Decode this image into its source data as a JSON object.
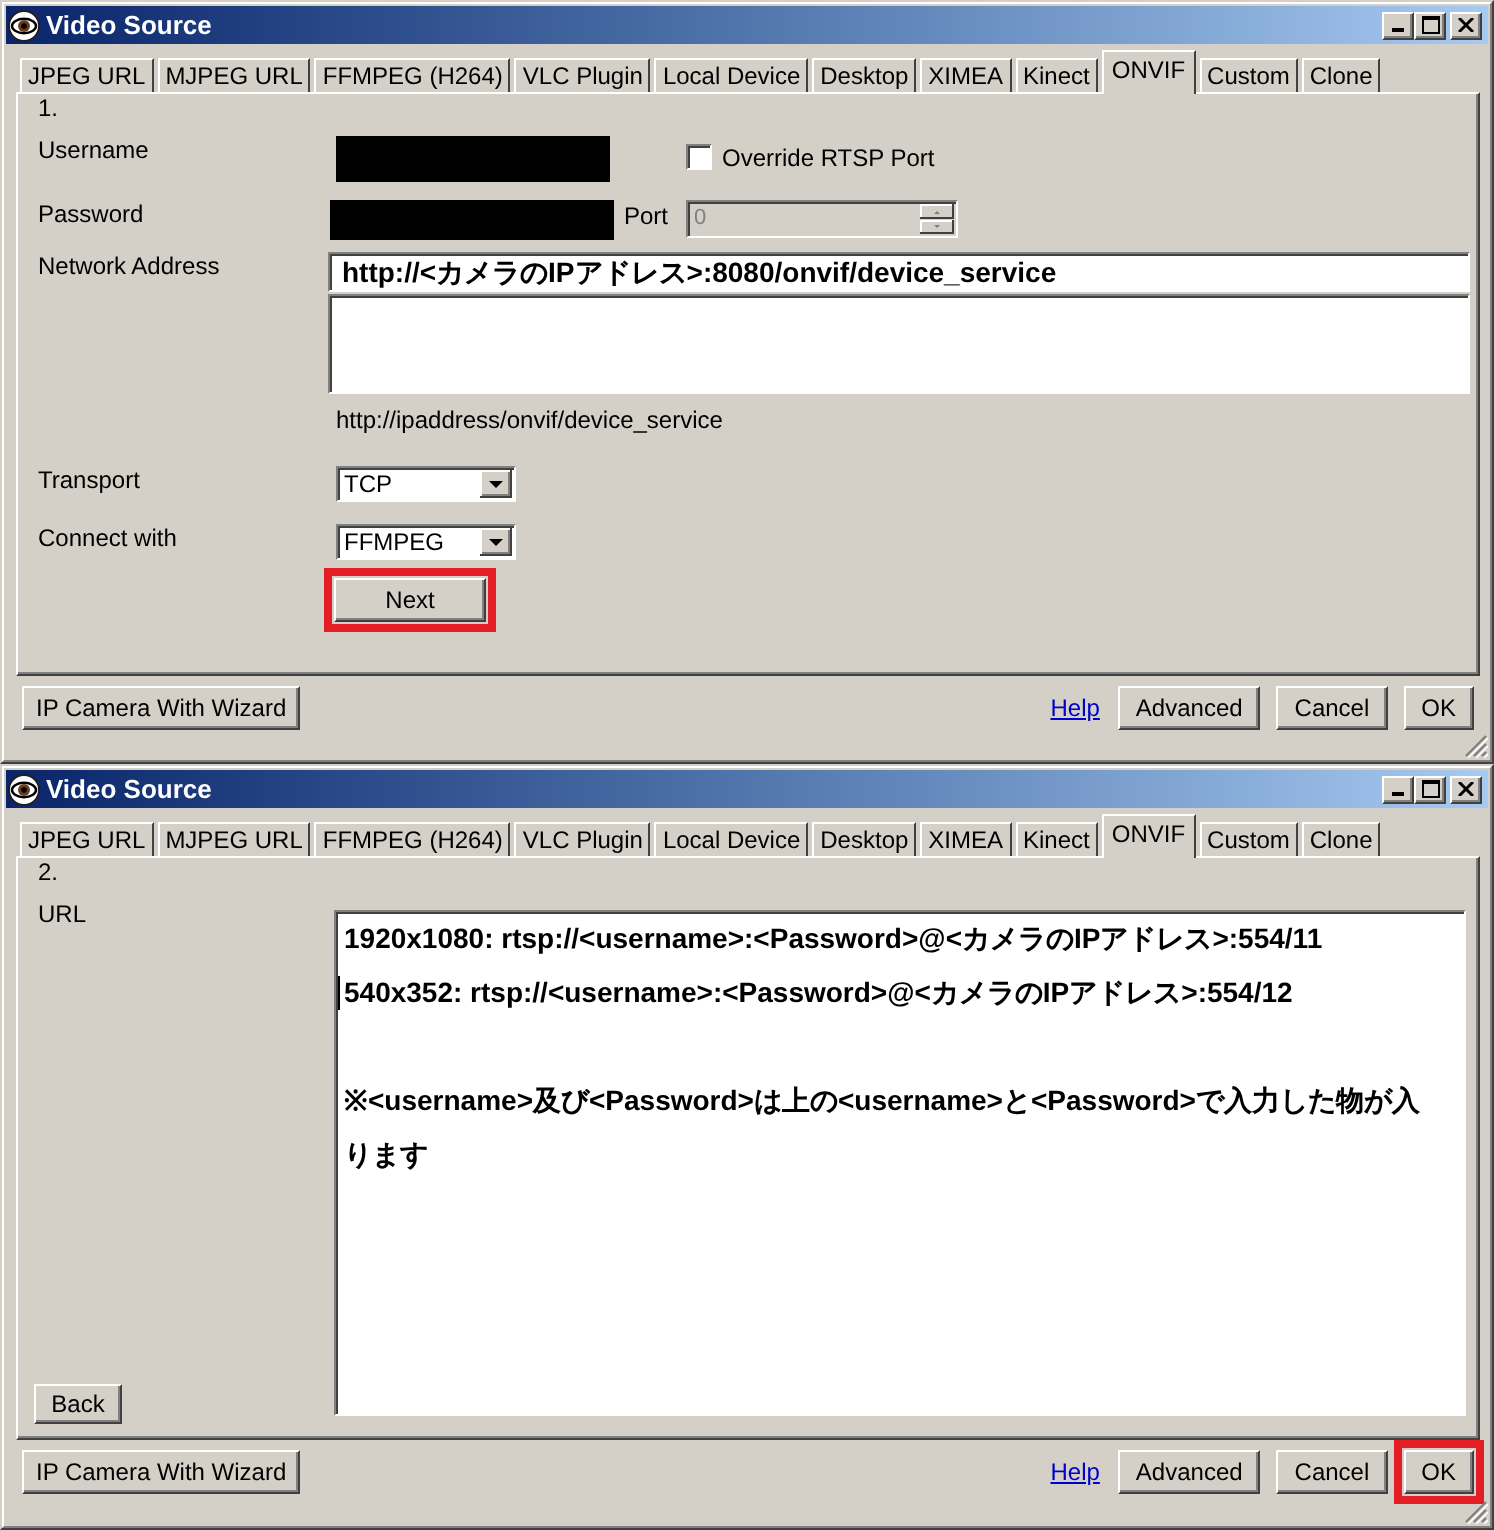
{
  "windows": [
    {
      "title": "Video Source",
      "tabs": [
        {
          "label": "JPEG URL",
          "selected": false
        },
        {
          "label": "MJPEG URL",
          "selected": false
        },
        {
          "label": "FFMPEG (H264)",
          "selected": false
        },
        {
          "label": "VLC Plugin",
          "selected": false
        },
        {
          "label": "Local Device",
          "selected": false
        },
        {
          "label": "Desktop",
          "selected": false
        },
        {
          "label": "XIMEA",
          "selected": false
        },
        {
          "label": "Kinect",
          "selected": false
        },
        {
          "label": "ONVIF",
          "selected": true
        },
        {
          "label": "Custom",
          "selected": false
        },
        {
          "label": "Clone",
          "selected": false
        }
      ],
      "panel": {
        "kind": "connection",
        "step": "1.",
        "username": {
          "label": "Username",
          "redacted": true
        },
        "override_rtsp_port": {
          "label": "Override RTSP Port",
          "checked": false
        },
        "password": {
          "label": "Password",
          "redacted": true
        },
        "port": {
          "label": "Port",
          "value": "0",
          "disabled": true
        },
        "network_address": {
          "label": "Network Address",
          "value": "http://<カメラのIPアドレス>:8080/onvif/device_service",
          "example": "http://ipaddress/onvif/device_service"
        },
        "transport": {
          "label": "Transport",
          "value": "TCP"
        },
        "connect_with": {
          "label": "Connect with",
          "value": "FFMPEG"
        },
        "next_button": {
          "label": "Next",
          "highlighted": true
        }
      },
      "footer": {
        "wizard_button": "IP Camera With Wizard",
        "help_link": "Help",
        "buttons": [
          {
            "label": "Advanced",
            "highlighted": false
          },
          {
            "label": "Cancel",
            "highlighted": false
          },
          {
            "label": "OK",
            "highlighted": false
          }
        ]
      }
    },
    {
      "title": "Video Source",
      "tabs": [
        {
          "label": "JPEG URL",
          "selected": false
        },
        {
          "label": "MJPEG URL",
          "selected": false
        },
        {
          "label": "FFMPEG (H264)",
          "selected": false
        },
        {
          "label": "VLC Plugin",
          "selected": false
        },
        {
          "label": "Local Device",
          "selected": false
        },
        {
          "label": "Desktop",
          "selected": false
        },
        {
          "label": "XIMEA",
          "selected": false
        },
        {
          "label": "Kinect",
          "selected": false
        },
        {
          "label": "ONVIF",
          "selected": true
        },
        {
          "label": "Custom",
          "selected": false
        },
        {
          "label": "Clone",
          "selected": false
        }
      ],
      "panel": {
        "kind": "urls",
        "step": "2.",
        "url": {
          "label": "URL",
          "lines": [
            {
              "text": "1920x1080: rtsp://<username>:<Password>@<カメラのIPアドレス>:554/11",
              "cursor": false
            },
            {
              "text": "540x352: rtsp://<username>:<Password>@<カメラのIPアドレス>:554/12",
              "cursor": true
            }
          ],
          "note": "※<username>及び<Password>は上の<username>と<Password>で入力した物が入ります"
        },
        "back_button": {
          "label": "Back",
          "highlighted": false
        }
      },
      "footer": {
        "wizard_button": "IP Camera With Wizard",
        "help_link": "Help",
        "buttons": [
          {
            "label": "Advanced",
            "highlighted": false
          },
          {
            "label": "Cancel",
            "highlighted": false
          },
          {
            "label": "OK",
            "highlighted": true
          }
        ]
      }
    }
  ]
}
